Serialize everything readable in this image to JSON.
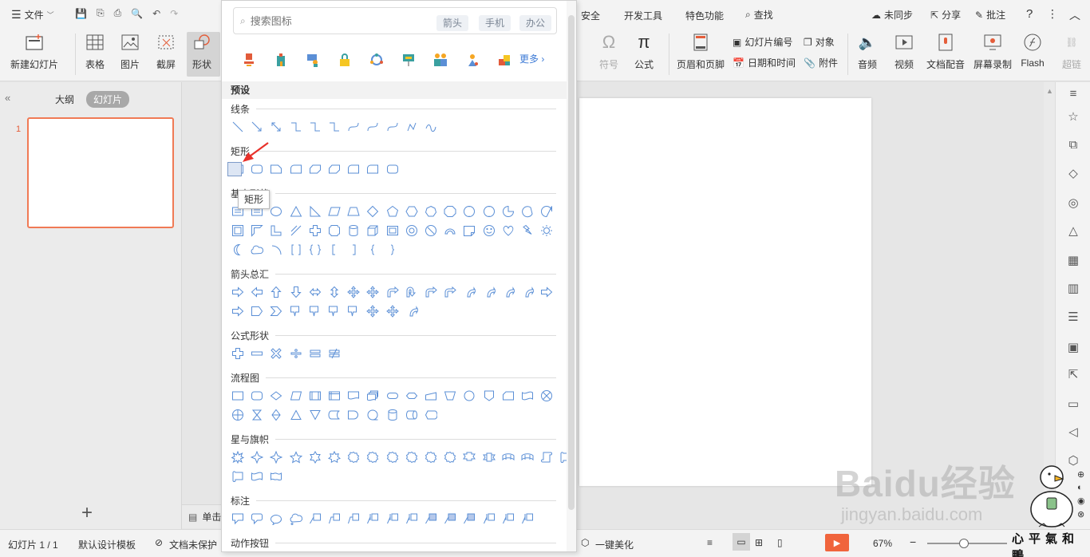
{
  "topbar": {
    "menu_label": "文件",
    "tabs": [
      "安全",
      "开发工具",
      "特色功能"
    ],
    "search_label": "查找",
    "sync_label": "未同步",
    "share_label": "分享",
    "comment_label": "批注"
  },
  "ribbon": {
    "new_slide": "新建幻灯片",
    "table": "表格",
    "picture": "图片",
    "screenshot": "截屏",
    "shape": "形状",
    "symbol": "符号",
    "formula": "公式",
    "header_footer": "页眉和页脚",
    "slide_number": "幻灯片编号",
    "date_time": "日期和时间",
    "object": "对象",
    "attachment": "附件",
    "audio": "音频",
    "video": "视频",
    "doc_dubbing": "文档配音",
    "screen_record": "屏幕录制",
    "flash": "Flash",
    "hyperlink": "超链"
  },
  "leftpanel": {
    "outline_tab": "大纲",
    "slides_tab": "幻灯片",
    "slide_number": "1",
    "add_label": "+"
  },
  "shapes_panel": {
    "search_placeholder": "搜索图标",
    "tags": [
      "箭头",
      "手机",
      "办公"
    ],
    "more_label": "更多",
    "preset_label": "预设",
    "categories": {
      "lines": "线条",
      "rectangles": "矩形",
      "basic": "基本形状",
      "arrows": "箭头总汇",
      "formula": "公式形状",
      "flowchart": "流程图",
      "stars": "星与旗帜",
      "callouts": "标注",
      "action": "动作按钮"
    },
    "tooltip": "矩形"
  },
  "notes": {
    "label": "单击"
  },
  "statusbar": {
    "slide_info": "幻灯片 1 / 1",
    "template": "默认设计模板",
    "protect": "文档未保护",
    "beautify": "一键美化",
    "zoom": "67%"
  },
  "colors": {
    "accent_orange": "#f07a55",
    "shape_blue": "#5b8fd6",
    "play_orange": "#f0643c"
  },
  "watermark": {
    "brand": "Baidu经验",
    "url": "jingyan.baidu.com",
    "corner_text": "心平氣和鴨"
  }
}
